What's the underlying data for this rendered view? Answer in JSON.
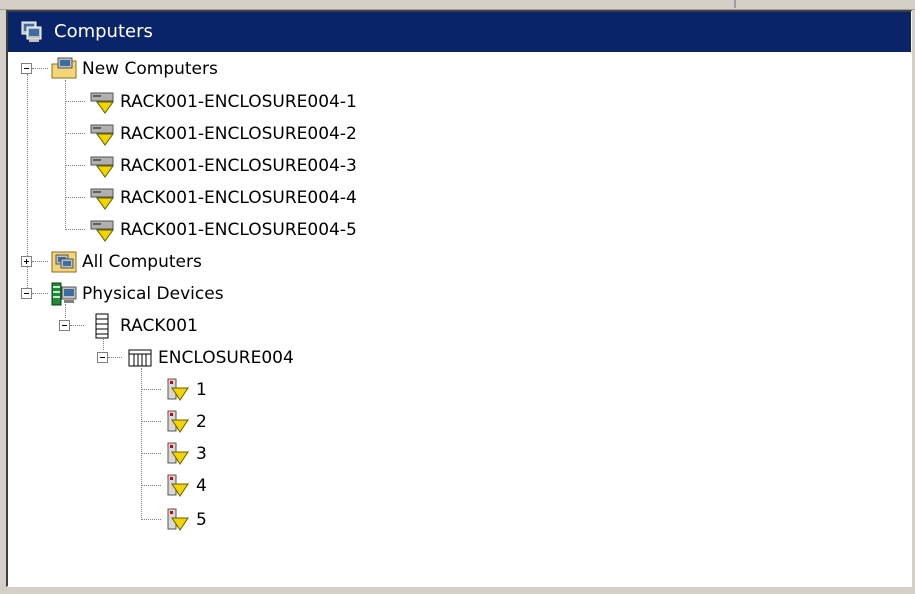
{
  "header": {
    "title": "Computers",
    "icon": "computers-group-icon",
    "accent_color": "#0a246a"
  },
  "tree": {
    "new_computers": {
      "label": "New Computers",
      "icon": "new-computers-folder-icon",
      "expanded": true,
      "items": [
        {
          "label": "RACK001-ENCLOSURE004-1",
          "icon": "computer-warning-icon"
        },
        {
          "label": "RACK001-ENCLOSURE004-2",
          "icon": "computer-warning-icon"
        },
        {
          "label": "RACK001-ENCLOSURE004-3",
          "icon": "computer-warning-icon"
        },
        {
          "label": "RACK001-ENCLOSURE004-4",
          "icon": "computer-warning-icon"
        },
        {
          "label": "RACK001-ENCLOSURE004-5",
          "icon": "computer-warning-icon"
        }
      ]
    },
    "all_computers": {
      "label": "All Computers",
      "icon": "all-computers-icon",
      "expanded": false
    },
    "physical_devices": {
      "label": "Physical Devices",
      "icon": "physical-devices-icon",
      "expanded": true,
      "rack": {
        "label": "RACK001",
        "icon": "rack-icon",
        "expanded": true,
        "enclosure": {
          "label": "ENCLOSURE004",
          "icon": "enclosure-icon",
          "expanded": true,
          "bays": [
            {
              "label": "1",
              "icon": "blade-warning-icon"
            },
            {
              "label": "2",
              "icon": "blade-warning-icon"
            },
            {
              "label": "3",
              "icon": "blade-warning-icon"
            },
            {
              "label": "4",
              "icon": "blade-warning-icon"
            },
            {
              "label": "5",
              "icon": "blade-warning-icon"
            }
          ]
        }
      }
    }
  }
}
